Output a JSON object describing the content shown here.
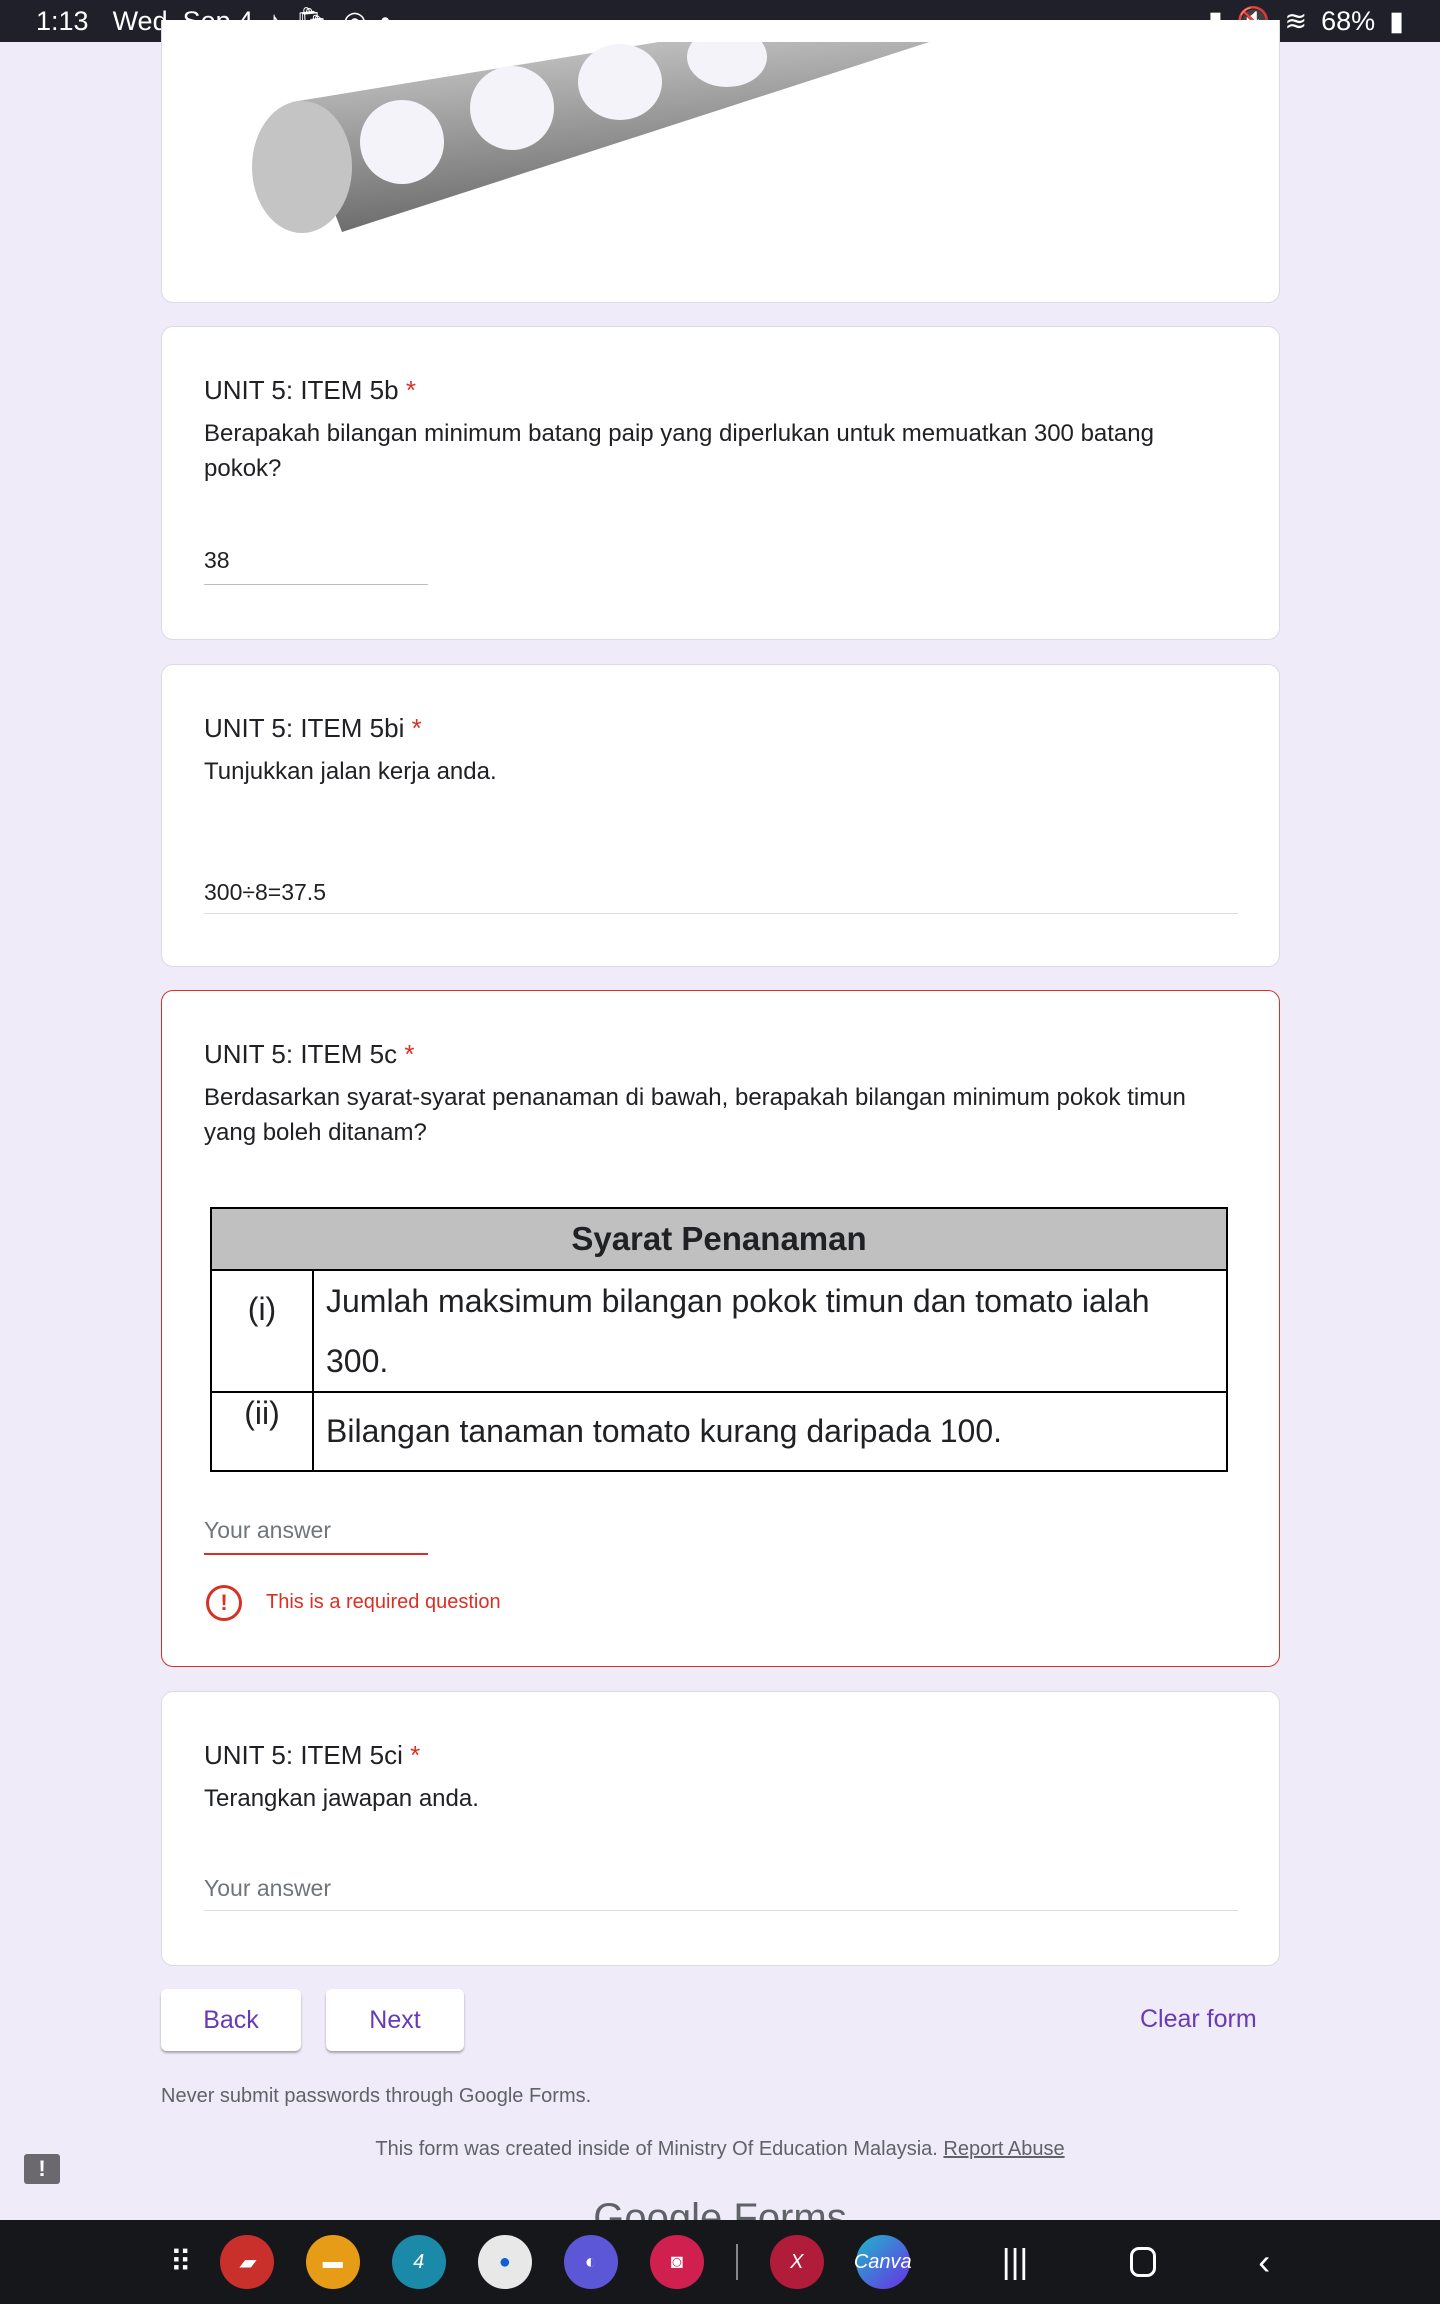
{
  "status": {
    "time": "1:13",
    "date": "Wed, Sep 4",
    "battery": "68%"
  },
  "q5b": {
    "title": "UNIT 5: ITEM 5b",
    "required": "*",
    "question": "Berapakah bilangan minimum batang paip yang diperlukan untuk memuatkan 300 batang pokok?",
    "answer": "38"
  },
  "q5bi": {
    "title": "UNIT 5: ITEM 5bi",
    "required": "*",
    "question": "Tunjukkan jalan kerja anda.",
    "answer": "300÷8=37.5"
  },
  "q5c": {
    "title": "UNIT 5: ITEM 5c",
    "required": "*",
    "question": "Berdasarkan syarat-syarat penanaman di bawah, berapakah bilangan minimum pokok timun yang boleh ditanam?",
    "table": {
      "header": "Syarat Penanaman",
      "rows": [
        {
          "num": "(i)",
          "text": "Jumlah maksimum bilangan pokok timun dan tomato ialah 300."
        },
        {
          "num": "(ii)",
          "text": "Bilangan tanaman tomato kurang daripada 100."
        }
      ]
    },
    "placeholder": "Your answer",
    "error": "This is a required question"
  },
  "q5ci": {
    "title": "UNIT 5: ITEM 5ci",
    "required": "*",
    "question": "Terangkan jawapan anda.",
    "placeholder": "Your answer"
  },
  "buttons": {
    "back": "Back",
    "next": "Next",
    "clear": "Clear form"
  },
  "footer": {
    "warning": "Never submit passwords through Google Forms.",
    "created": "This form was created inside of Ministry Of Education Malaysia.",
    "report": "Report Abuse",
    "logo": "Google Forms"
  },
  "colors": {
    "accent": "#673ab7",
    "error": "#d93025",
    "background": "#efebf8"
  }
}
